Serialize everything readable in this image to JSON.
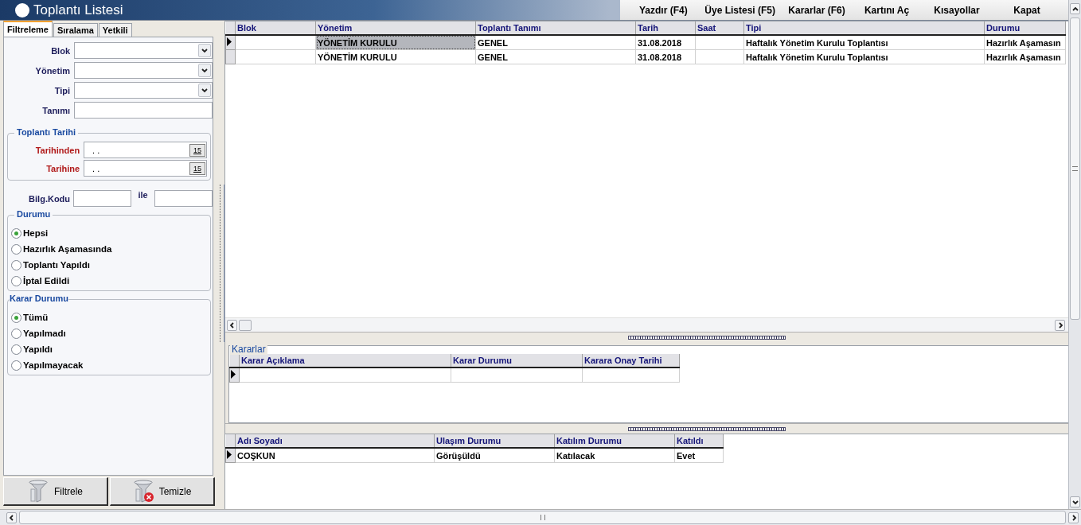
{
  "window": {
    "title": "Toplantı Listesi"
  },
  "toolbar": [
    "Yazdır (F4)",
    "Üye Listesi (F5)",
    "Kararlar (F6)",
    "Kartını Aç",
    "Kısayollar",
    "Kapat"
  ],
  "left_tabs": [
    {
      "label": "Filtreleme",
      "selected": true
    },
    {
      "label": "Sıralama",
      "selected": false
    },
    {
      "label": "Yetkili",
      "selected": false
    }
  ],
  "filters": {
    "fields": [
      {
        "kind": "combo",
        "label": "Blok"
      },
      {
        "kind": "combo",
        "label": "Yönetim"
      },
      {
        "kind": "combo",
        "label": "Tipi"
      },
      {
        "kind": "text",
        "label": "Tanımı"
      }
    ],
    "date_group": {
      "title": "Toplantı Tarihi",
      "fields": [
        {
          "label": "Tarihinden",
          "value": ".  .",
          "button_label": "15"
        },
        {
          "label": "Tarihine",
          "value": ".  .",
          "button_label": "15"
        }
      ]
    },
    "code_range": {
      "label": "Bilg.Kodu",
      "separator": "ile"
    },
    "radio_groups": [
      {
        "title": "Durumu",
        "options": [
          {
            "label": "Hepsi",
            "selected": true
          },
          {
            "label": "Hazırlık Aşamasında",
            "selected": false
          },
          {
            "label": "Toplantı Yapıldı",
            "selected": false
          },
          {
            "label": "İptal Edildi",
            "selected": false
          }
        ]
      },
      {
        "title": "Karar Durumu",
        "options": [
          {
            "label": "Tümü",
            "selected": true
          },
          {
            "label": "Yapılmadı",
            "selected": false
          },
          {
            "label": "Yapıldı",
            "selected": false
          },
          {
            "label": "Yapılmayacak",
            "selected": false
          }
        ]
      }
    ],
    "buttons": [
      {
        "kind": "filter",
        "label": "Filtrele"
      },
      {
        "kind": "clear",
        "label": "Temizle"
      }
    ]
  },
  "meetings": {
    "columns": [
      "Blok",
      "Yönetim",
      "Toplantı Tanımı",
      "Tarih",
      "Saat",
      "Tipi",
      "Durumu"
    ],
    "rows": [
      {
        "selected": true,
        "cells": [
          {
            "focused": false
          },
          {
            "text": "YÖNETİM KURULU",
            "focused": true
          },
          {
            "text": "GENEL",
            "focused": false
          },
          {
            "text": "31.08.2018",
            "focused": false
          },
          {
            "focused": false
          },
          {
            "text": "Haftalık Yönetim Kurulu Toplantısı",
            "focused": false
          },
          {
            "text": "Hazırlık Aşamasın",
            "focused": false
          }
        ]
      },
      {
        "selected": false,
        "cells": [
          {
            "focused": false
          },
          {
            "text": "YÖNETİM KURULU",
            "focused": false
          },
          {
            "text": "GENEL",
            "focused": false
          },
          {
            "text": "31.08.2018",
            "focused": false
          },
          {
            "focused": false
          },
          {
            "text": "Haftalık Yönetim Kurulu Toplantısı",
            "focused": false
          },
          {
            "text": "Hazırlık Aşamasın",
            "focused": false
          }
        ]
      }
    ]
  },
  "decisions": {
    "title": "Kararlar",
    "columns": [
      "Karar Açıklama",
      "Karar Durumu",
      "Karara Onay Tarihi"
    ],
    "rows": [
      {
        "selected": true
      }
    ]
  },
  "attendees": {
    "columns": [
      "Adı Soyadı",
      "Ulaşım Durumu",
      "Katılım Durumu",
      "Katıldı"
    ],
    "rows": [
      {
        "selected": true,
        "cells": [
          "COŞKUN",
          "Görüşüldü",
          "Katılacak",
          "Evet"
        ]
      }
    ]
  }
}
